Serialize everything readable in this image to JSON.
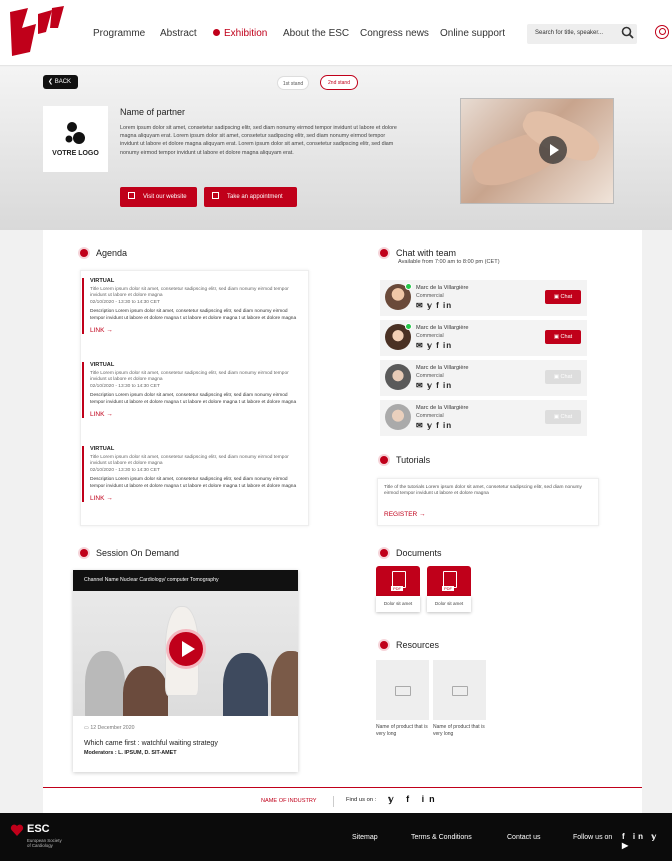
{
  "nav": {
    "items": [
      "Programme",
      "Abstract",
      "Exhibition",
      "About the ESC",
      "Congress news",
      "Online support"
    ],
    "active": "Exhibition",
    "search_placeholder": "Search for title, speaker...",
    "accent": "#c0001a"
  },
  "banner": {
    "back_label": "BACK",
    "stand1": "1st stand",
    "stand2": "2nd stand",
    "logo_text": "VOTRE LOGO",
    "partner_name": "Name of partner",
    "partner_desc": "Lorem ipsum dolor sit amet, consetetur sadipscing elitr, sed diam nonumy eirmod tempor invidunt ut labore et dolore magna aliquyam erat. Lorem ipsum dolor sit amet, consetetur sadipscing elitr, sed diam nonumy eirmod tempor invidunt ut labore et dolore magna aliquyam erat. Lorem ipsum dolor sit amet, consetetur sadipscing elitr, sed diam nonumy eirmod tempor invidunt ut labore et dolore magna aliquyam erat.",
    "visit_label": "Visit our website",
    "appointment_label": "Take an appointment"
  },
  "agenda": {
    "title": "Agenda",
    "items": [
      {
        "kind": "VIRTUAL",
        "title": "Title Lorem ipsum dolor sit amet, consetetur sadipscing elitr, sed diam nonumy eirmod tempor invidunt ut labore et dolore magna",
        "date": "02/10/2020 - 13:30 to 14:30 CET",
        "desc": "Description Lorem ipsum dolor sit amet, consetetur sadipscing elitr, sed diam nonumy eirmod tempor invidunt ut labore et dolore magna t ut labore et dolore magna t ut labore et dolore magna",
        "link": "LINK →"
      },
      {
        "kind": "VIRTUAL",
        "title": "Title Lorem ipsum dolor sit amet, consetetur sadipscing elitr, sed diam nonumy eirmod tempor invidunt ut labore et dolore magna",
        "date": "02/10/2020 - 13:30 to 14:30 CET",
        "desc": "Description Lorem ipsum dolor sit amet, consetetur sadipscing elitr, sed diam nonumy eirmod tempor invidunt ut labore et dolore magna t ut labore et dolore magna t ut labore et dolore magna",
        "link": "LINK →"
      },
      {
        "kind": "VIRTUAL",
        "title": "Title Lorem ipsum dolor sit amet, consetetur sadipscing elitr, sed diam nonumy eirmod tempor invidunt ut labore et dolore magna",
        "date": "02/10/2020 - 13:30 to 14:30 CET",
        "desc": "Description Lorem ipsum dolor sit amet, consetetur sadipscing elitr, sed diam nonumy eirmod tempor invidunt ut labore et dolore magna t ut labore et dolore magna t ut labore et dolore magna",
        "link": "LINK →"
      }
    ]
  },
  "chat": {
    "title": "Chat with team",
    "availability": "Available from 7:00 am to 8:00 pm (CET)",
    "chat_label": "Chat",
    "members": [
      {
        "name": "Marc de la Villargière",
        "role": "Commercial",
        "online": true
      },
      {
        "name": "Marc de la Villargière",
        "role": "Commercial",
        "online": true
      },
      {
        "name": "Marc de la Villargière",
        "role": "Commercial",
        "online": false
      },
      {
        "name": "Marc de la Villargière",
        "role": "Commercial",
        "online": false
      }
    ]
  },
  "tutorials": {
    "title": "Tutorials",
    "text": "Title of the tutorials Lorem ipsum dolor sit amet, consetetur sadipscing elitr, sed diam nonumy eirmod tempor invidunt ut labore et dolore magna",
    "register": "REGISTER →"
  },
  "session": {
    "title": "Session On Demand",
    "channel": "Channel Name Nuclear Cardiology/ computer Tomography",
    "date": "12 December 2020",
    "video_title": "Which came first : watchful waiting strategy",
    "moderators": "Moderators : L. IPSUM, D. SIT-AMET"
  },
  "documents": {
    "title": "Documents",
    "items": [
      "Dolor sit amet",
      "Dolor sit amet"
    ]
  },
  "resources": {
    "title": "Resources",
    "items": [
      "Name of product that is very long",
      "Name of product that is very long"
    ]
  },
  "footer": {
    "industry": "NAME OF INDUSTRY",
    "find_us": "Find us on :",
    "esc": "ESC",
    "esc_sub1": "European Society",
    "esc_sub2": "of Cardiology",
    "links": [
      "Sitemap",
      "Terms & Conditions",
      "Contact us",
      "Follow us on"
    ]
  }
}
